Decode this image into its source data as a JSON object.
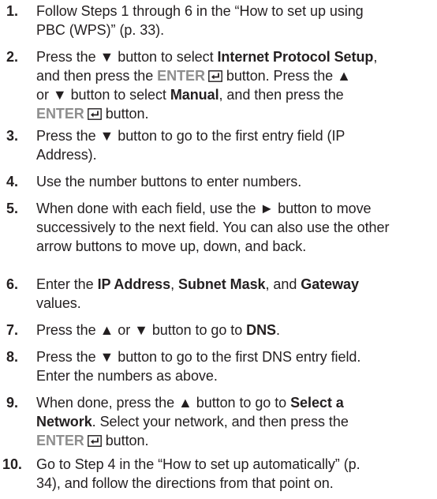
{
  "steps": [
    {
      "number": "1.",
      "lines": [
        [
          {
            "t": "Follow Steps 1 through 6 in the “How to set up using"
          }
        ],
        [
          {
            "t": "PBC (WPS)” (p. 33)."
          }
        ]
      ]
    },
    {
      "number": "2.",
      "lines": [
        [
          {
            "t": "Press the ▼ button to select "
          },
          {
            "t": "Internet Protocol Setup",
            "s": "b"
          },
          {
            "t": ","
          }
        ],
        [
          {
            "t": "and then press the "
          },
          {
            "t": "ENTER",
            "s": "enter"
          },
          {
            "icon": "enter-key-icon"
          },
          {
            "t": " button. Press the ▲"
          }
        ],
        [
          {
            "t": "or ▼ button to select "
          },
          {
            "t": "Manual",
            "s": "b"
          },
          {
            "t": ", and then press the"
          }
        ],
        [
          {
            "t": "ENTER",
            "s": "enter"
          },
          {
            "icon": "enter-key-icon"
          },
          {
            "t": " button."
          }
        ]
      ]
    },
    {
      "number": "3.",
      "lines": [
        [
          {
            "t": "Press the ▼ button to go to the first entry field (IP"
          }
        ],
        [
          {
            "t": "Address)."
          }
        ]
      ]
    },
    {
      "number": "4.",
      "lines": [
        [
          {
            "t": "Use the number buttons to enter numbers."
          }
        ]
      ]
    },
    {
      "number": "5.",
      "lines": [
        [
          {
            "t": "When done with each field, use the ► button to move"
          }
        ],
        [
          {
            "t": "successively to the next field. You can also use the other"
          }
        ],
        [
          {
            "t": "arrow buttons to move up, down, and back."
          }
        ]
      ]
    },
    {
      "number": "6.",
      "lines": [
        [
          {
            "t": "Enter the "
          },
          {
            "t": "IP Address",
            "s": "b"
          },
          {
            "t": ", "
          },
          {
            "t": "Subnet Mask",
            "s": "b"
          },
          {
            "t": ", and "
          },
          {
            "t": "Gateway",
            "s": "b"
          }
        ],
        [
          {
            "t": "values."
          }
        ]
      ]
    },
    {
      "number": "7.",
      "lines": [
        [
          {
            "t": "Press the ▲ or ▼ button to go to "
          },
          {
            "t": "DNS",
            "s": "b"
          },
          {
            "t": "."
          }
        ]
      ]
    },
    {
      "number": "8.",
      "lines": [
        [
          {
            "t": "Press the ▼ button to go to the first DNS entry field."
          }
        ],
        [
          {
            "t": "Enter the numbers as above."
          }
        ]
      ]
    },
    {
      "number": "9.",
      "lines": [
        [
          {
            "t": "When done, press the ▲ button to go to "
          },
          {
            "t": "Select a",
            "s": "b"
          }
        ],
        [
          {
            "t": "Network",
            "s": "b"
          },
          {
            "t": ". Select your network, and then press the"
          }
        ],
        [
          {
            "t": "ENTER",
            "s": "enter"
          },
          {
            "icon": "enter-key-icon"
          },
          {
            "t": " button."
          }
        ]
      ]
    },
    {
      "number": "10.",
      "lines": [
        [
          {
            "t": "Go to Step 4 in the “How to set up automatically” (p."
          }
        ],
        [
          {
            "t": "34), and follow the directions from that point on."
          }
        ]
      ]
    }
  ]
}
